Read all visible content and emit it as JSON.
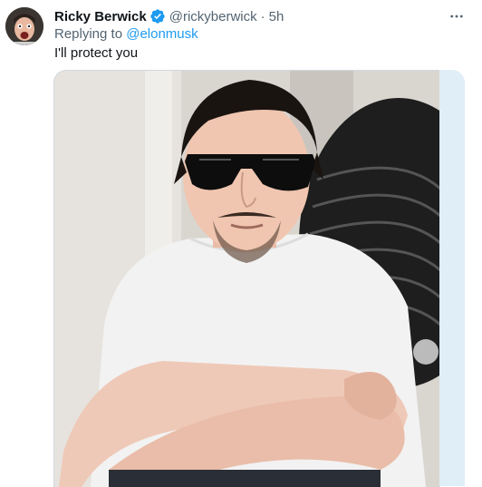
{
  "tweet": {
    "author_name": "Ricky Berwick",
    "author_handle": "@rickyberwick",
    "separator": "·",
    "timestamp": "5h",
    "replying_prefix": "Replying to ",
    "replying_to_handle": "@elonmusk",
    "text": "I'll protect you",
    "verified": true,
    "more_icon": "more-horizontal-icon",
    "verified_icon": "verified-badge-icon"
  },
  "colors": {
    "accent": "#1d9bf0",
    "secondary_text": "#536471",
    "primary_text": "#0f1419"
  }
}
